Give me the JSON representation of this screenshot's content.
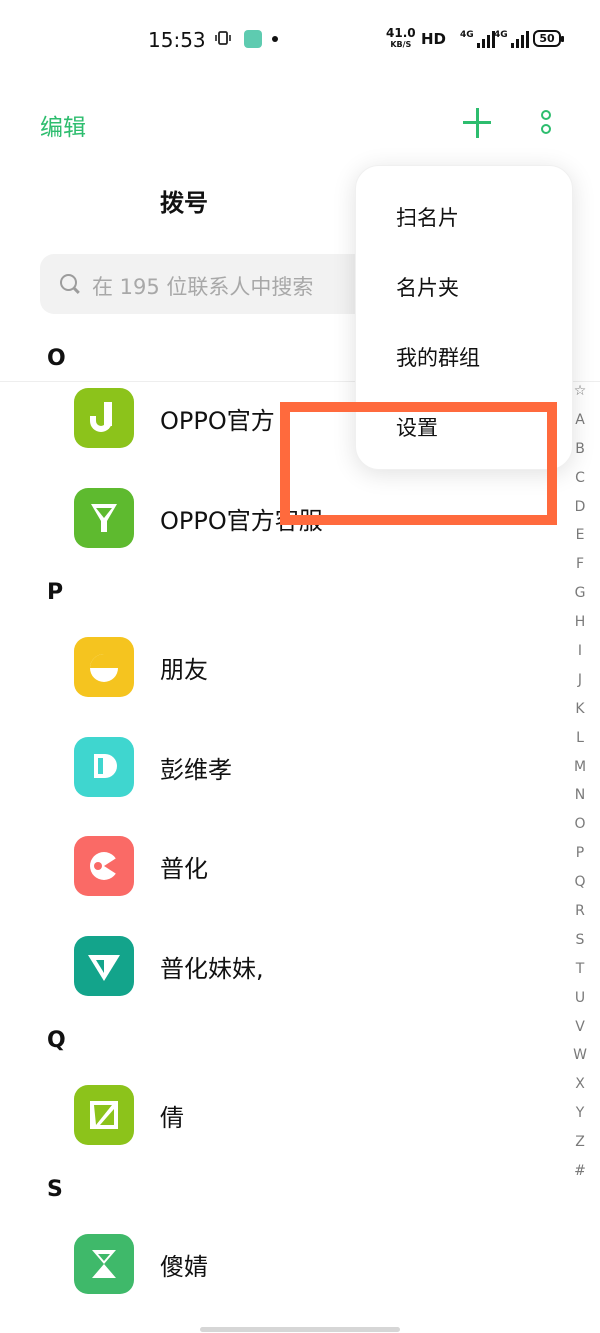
{
  "status_bar": {
    "time": "15:53",
    "vibrate_icon": "vibrate-icon",
    "speed_value": "41.0",
    "speed_unit": "KB/S",
    "hd_label": "HD",
    "signal1_label": "4G",
    "signal2_label": "4G",
    "battery": "50"
  },
  "toolbar": {
    "edit_label": "编辑",
    "add_icon": "plus-icon",
    "more_icon": "more-vertical-icon",
    "accent_color": "#2dbd6e"
  },
  "tabs": {
    "dial_label": "拨号"
  },
  "search": {
    "placeholder": "在 195 位联系人中搜索"
  },
  "contacts": {
    "sections": [
      {
        "letter": "O"
      },
      {
        "letter": "P"
      },
      {
        "letter": "Q"
      },
      {
        "letter": "S"
      }
    ],
    "items": [
      {
        "name": "OPPO官方",
        "avatar_color": "#8cc31b",
        "section": "O"
      },
      {
        "name": "OPPO官方客服",
        "avatar_color": "#5eba2f",
        "section": "O"
      },
      {
        "name": "朋友",
        "avatar_color": "#f5c41f",
        "section": "P"
      },
      {
        "name": "彭维孝",
        "avatar_color": "#3fd6cf",
        "section": "P"
      },
      {
        "name": "普化",
        "avatar_color": "#fa6a66",
        "section": "P"
      },
      {
        "name": "普化妹妹,",
        "avatar_color": "#13a48b",
        "section": "P"
      },
      {
        "name": "倩",
        "avatar_color": "#8cc31b",
        "section": "Q"
      },
      {
        "name": "傻婧",
        "avatar_color": "#3fb96a",
        "section": "S"
      }
    ]
  },
  "alpha_index": [
    "☆",
    "A",
    "B",
    "C",
    "D",
    "E",
    "F",
    "G",
    "H",
    "I",
    "J",
    "K",
    "L",
    "M",
    "N",
    "O",
    "P",
    "Q",
    "R",
    "S",
    "T",
    "U",
    "V",
    "W",
    "X",
    "Y",
    "Z",
    "#"
  ],
  "popup_menu": {
    "items": [
      "扫名片",
      "名片夹",
      "我的群组",
      "设置"
    ]
  },
  "highlight": {
    "color": "#ff6a3d"
  }
}
